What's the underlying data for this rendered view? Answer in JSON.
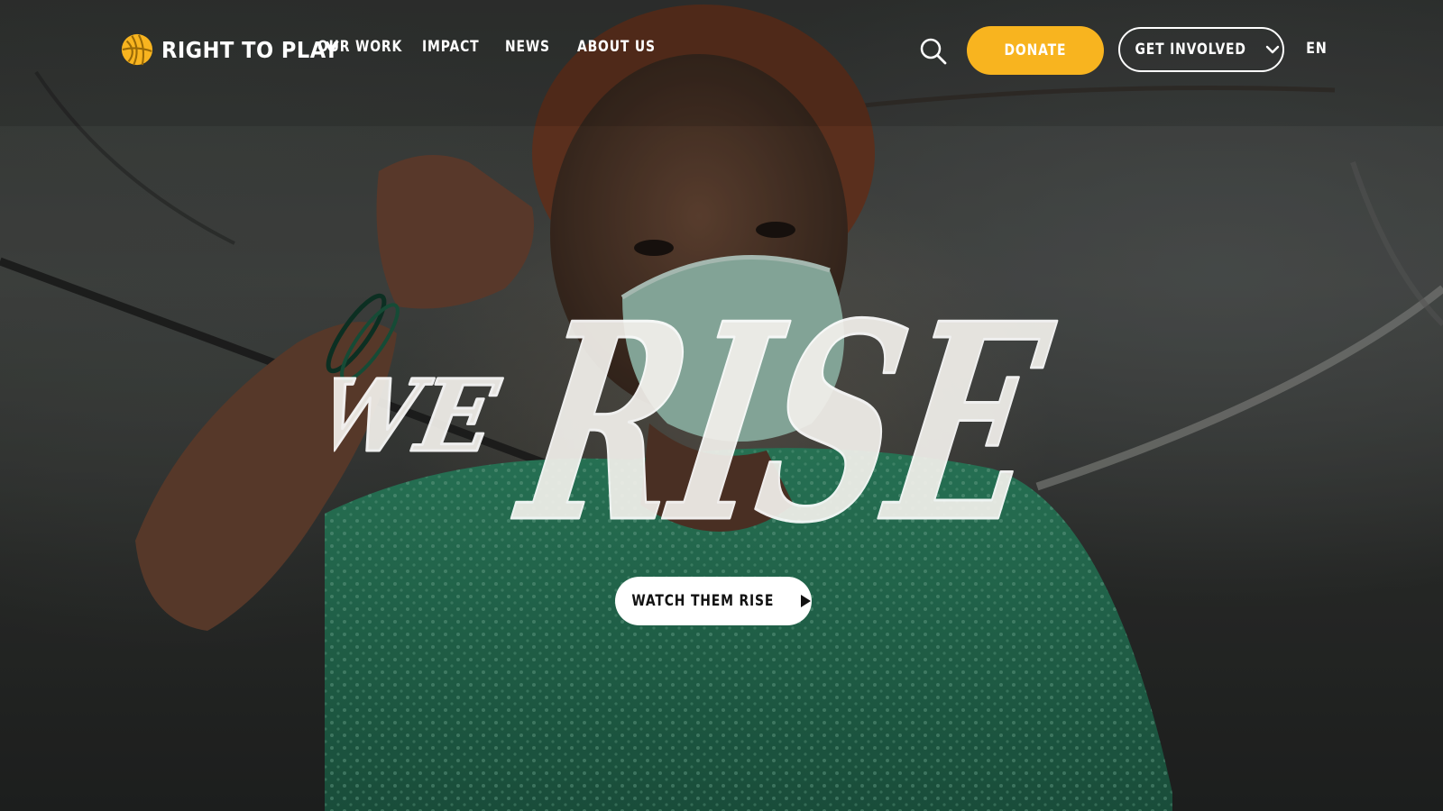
{
  "brand": {
    "name": "RIGHT TO PLAY",
    "accent": "#f8b41f",
    "logo_icon": "yellow-ball-logo-icon"
  },
  "nav": {
    "links": [
      "OUR WORK",
      "IMPACT",
      "NEWS",
      "ABOUT US"
    ]
  },
  "actions": {
    "search_icon": "search-icon",
    "donate_label": "DONATE",
    "get_involved_label": "GET INVOLVED",
    "get_involved_icon": "chevron-down-icon",
    "language": "EN"
  },
  "hero": {
    "headline_small": "WE",
    "headline_large": "RISE",
    "cta_label": "WATCH THEM RISE",
    "cta_icon": "play-icon"
  }
}
